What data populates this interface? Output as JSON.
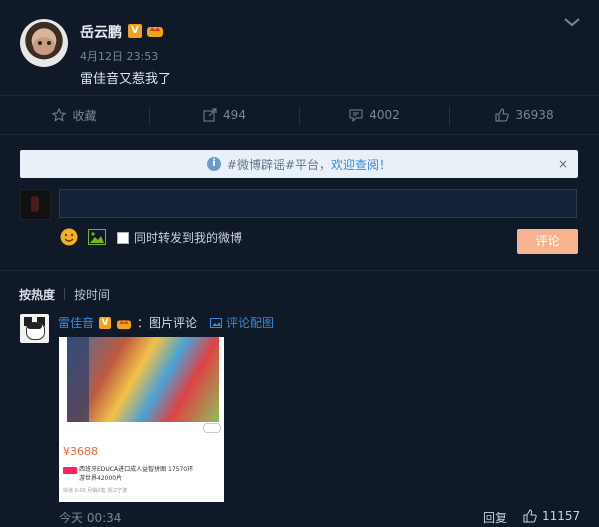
{
  "post": {
    "username": "岳云鹏",
    "badge_v": "V",
    "time": "4月12日 23:53",
    "text": "雷佳音又惹我了"
  },
  "actions": {
    "favorite": "收藏",
    "repost_count": "494",
    "comment_count": "4002",
    "like_count": "36938"
  },
  "notice": {
    "prefix": "#微博辟谣#平台，",
    "link": "欢迎查阅！",
    "close": "×"
  },
  "composer": {
    "repost_option": "同时转发到我的微博",
    "submit": "评论"
  },
  "sort": {
    "hot": "按热度",
    "time": "按时间"
  },
  "comment": {
    "username": "雷佳音",
    "badge_v": "V",
    "text": "：图片评论",
    "link": "评论配图",
    "time": "今天 00:34",
    "reply": "回复",
    "like_count": "11157",
    "image": {
      "price": "¥3688",
      "title": "西班牙EDUCA进口成人益智拼图 17570环游世界42000片",
      "meta": "快递 0.00  月销0笔  浙江宁波"
    }
  }
}
